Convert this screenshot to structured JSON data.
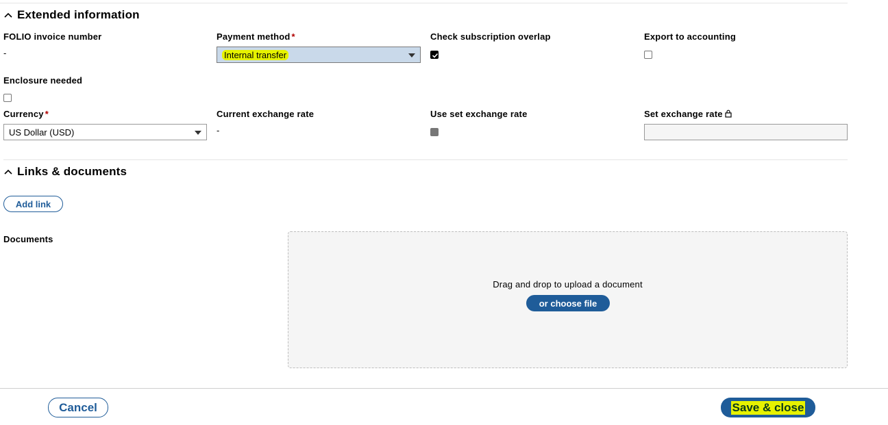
{
  "extended": {
    "title": "Extended information",
    "folio_invoice_number": {
      "label": "FOLIO invoice number",
      "value": "-"
    },
    "payment_method": {
      "label": "Payment method",
      "required": "*",
      "value": "Internal transfer"
    },
    "check_subscription_overlap": {
      "label": "Check subscription overlap",
      "checked": true
    },
    "export_to_accounting": {
      "label": "Export to accounting",
      "checked": false
    },
    "enclosure_needed": {
      "label": "Enclosure needed",
      "checked": false
    },
    "currency": {
      "label": "Currency",
      "required": "*",
      "value": "US Dollar (USD)"
    },
    "current_exchange_rate": {
      "label": "Current exchange rate",
      "value": "-"
    },
    "use_set_exchange_rate": {
      "label": "Use set exchange rate",
      "disabled": true
    },
    "set_exchange_rate": {
      "label": "Set exchange rate",
      "value": ""
    }
  },
  "links_documents": {
    "title": "Links & documents",
    "add_link_label": "Add link",
    "documents_label": "Documents",
    "drop_text": "Drag and drop to upload a document",
    "choose_file_label": "or choose file"
  },
  "footer": {
    "cancel_label": "Cancel",
    "save_label": "Save & close"
  },
  "colors": {
    "accent": "#1f5c99",
    "highlight": "#e6f200",
    "required": "#b00000",
    "selected_select_bg": "#c9d9ea"
  },
  "icons": {
    "collapse": "chevron-up-icon",
    "lock": "lock-icon",
    "check": "checkmark-icon",
    "dropdown": "caret-down-icon"
  }
}
